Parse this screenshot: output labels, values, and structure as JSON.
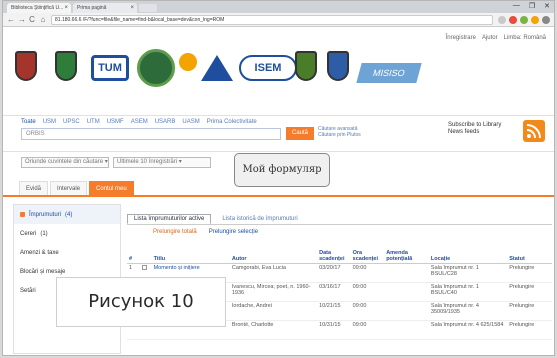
{
  "browser": {
    "tabs": [
      {
        "label": "Biblioteca Ştiinţifică U..."
      },
      {
        "label": "Prima pagină"
      }
    ],
    "window_controls": [
      "—",
      "❐",
      "✕"
    ],
    "address": "81.180.66.6 /F/?func=file&file_name=find-b&local_base=dev&con_lng=ROM"
  },
  "banner": {
    "toplinks": [
      "Înregistrare",
      "Ajutor",
      "Limba: Română"
    ]
  },
  "search": {
    "tabs": [
      "Toate",
      "USM",
      "UPSC",
      "UTM",
      "USMF",
      "ASEM",
      "USARB",
      "UASM",
      "Prima Colectivitate"
    ],
    "input_value": "ORBIS",
    "button_label": "Caută",
    "links": [
      "Căutare avansată",
      "Căutare prin Plutos"
    ],
    "subscribe": "Subscribe to Library News feeds"
  },
  "filters": {
    "scope": "Oriunde cuvintele din căutare ▾",
    "location": "Ultimele 10 înregistrări ▾"
  },
  "annotation_bubble": "Мой формуляр",
  "user_tabs": [
    "Evidă",
    "Intervale",
    "Contul meu"
  ],
  "sidebar": {
    "items": [
      {
        "label": "Împrumuturi",
        "count": "(4)"
      },
      {
        "label": "Cereri",
        "count": "(1)"
      },
      {
        "label": "Amenzi & taxe",
        "count": ""
      },
      {
        "label": "Blocări și mesaje",
        "count": ""
      },
      {
        "label": "Setări",
        "count": ""
      }
    ]
  },
  "loans": {
    "subtabs": [
      "Lista împrumuturilor active",
      "Lista istorică de împrumuturi"
    ],
    "actions": [
      "Prelungire totală",
      "Prelungire selecție"
    ],
    "columns": [
      "#",
      "",
      "Titlu",
      "Autor",
      "Data scadenței",
      "Ora scadenței",
      "Amenda potențială",
      "Locație",
      "Statut"
    ],
    "rows": [
      {
        "num": "1",
        "title": "Momento și inițiere",
        "author": "Camgorabi, Eva Lucia",
        "date": "03/20/17",
        "time": "09:00",
        "fine": "",
        "location": "Sala împrumut nr. 1 BSUL/C28",
        "status": "Prelungire"
      },
      {
        "num": "2",
        "title": "",
        "author": "Ivanescu, Mircea; poet, n. 1960-1936",
        "date": "03/16/17",
        "time": "09:00",
        "fine": "",
        "location": "Sala împrumut nr. 1 BSUL/C40",
        "status": "Prelungire"
      },
      {
        "num": "3",
        "title": "",
        "author": "Iordache, Andrei",
        "date": "10/21/15",
        "time": "09:00",
        "fine": "",
        "location": "Sala împrumut nr. 4 35009/1935",
        "status": "Prelungire"
      },
      {
        "num": "4",
        "title": "Jane Eyre",
        "author": "Brontë, Charlotte",
        "date": "10/31/15",
        "time": "09:00",
        "fine": "",
        "location": "Sala împrumut nr. 4 625/1584",
        "status": "Prelungire"
      }
    ]
  },
  "figure_caption": "Рисунок 10",
  "colors": {
    "accent": "#f47c2b",
    "link": "#1f4ea1"
  }
}
